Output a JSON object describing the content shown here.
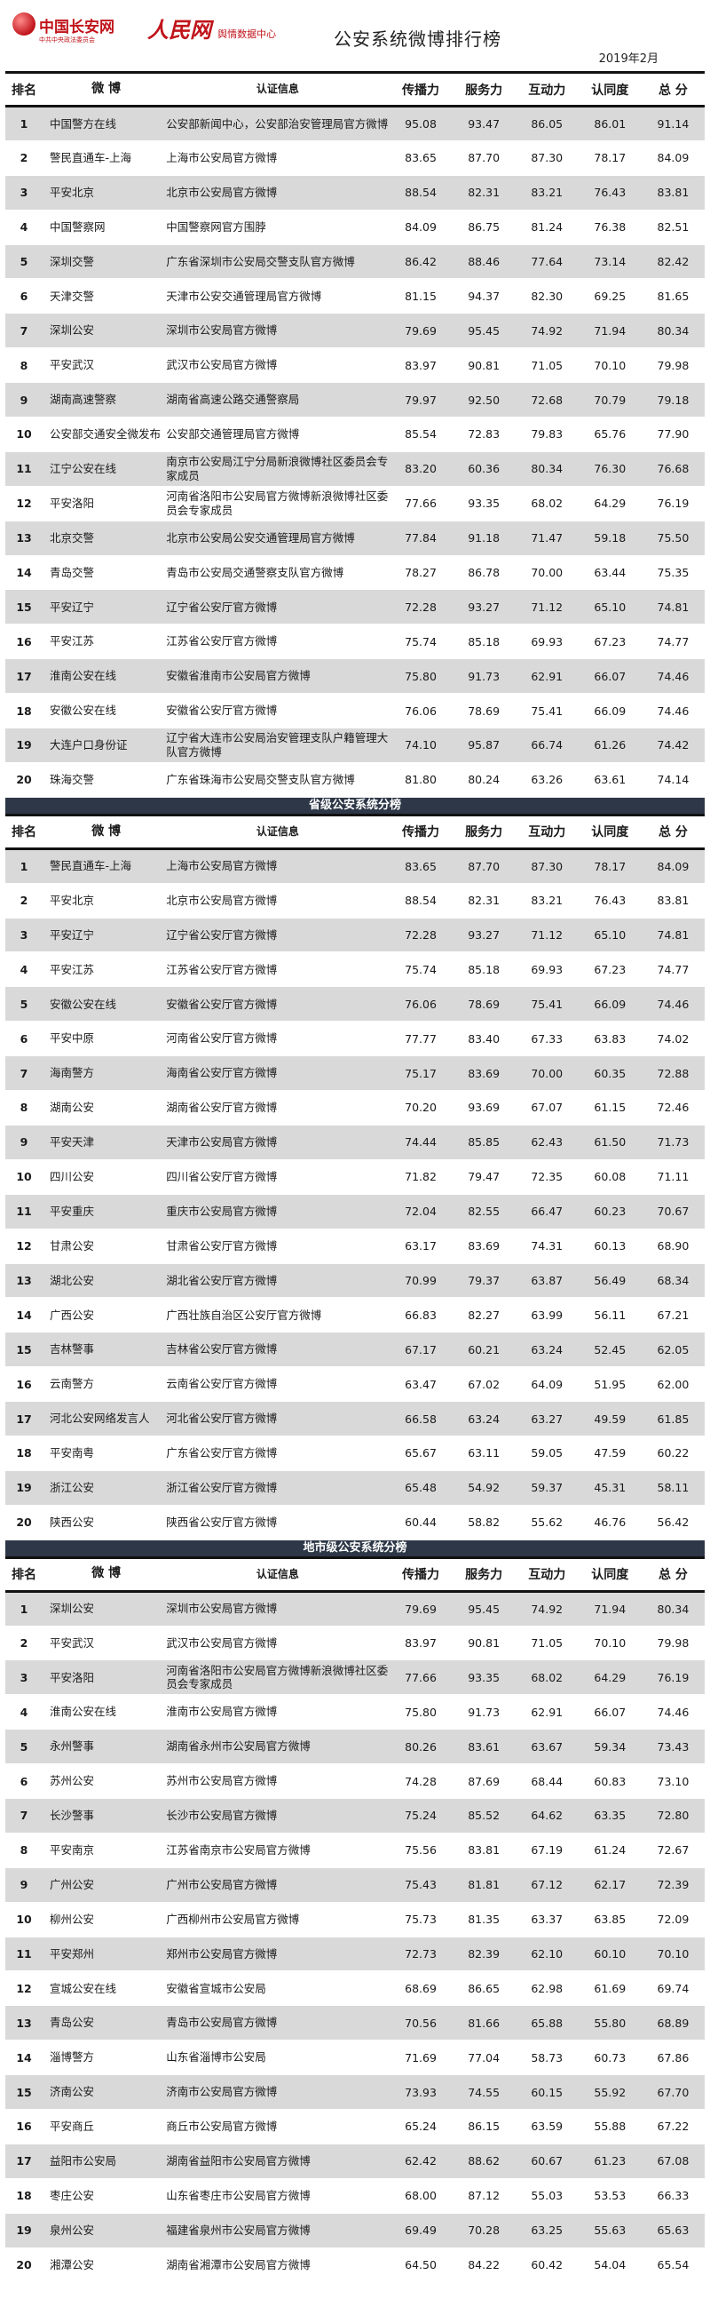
{
  "header": {
    "logo_name": "中国长安网",
    "logo_sub": "中共中央政法委员会",
    "rmw_brand": "人民网",
    "rmw_center": "舆情数据中心",
    "title": "公安系统微博排行榜",
    "date": "2019年2月"
  },
  "columns": {
    "rank": "排名",
    "name": "微  博",
    "cert": "认证信息",
    "spread": "传播力",
    "service": "服务力",
    "interact": "互动力",
    "recog": "认同度",
    "total": "总  分"
  },
  "sections": [
    {
      "title": "",
      "rows": [
        {
          "rank": "1",
          "name": "中国警方在线",
          "cert": "公安部新闻中心，公安部治安管理局官方微博",
          "spread": "95.08",
          "service": "93.47",
          "interact": "86.05",
          "recog": "86.01",
          "total": "91.14"
        },
        {
          "rank": "2",
          "name": "警民直通车-上海",
          "cert": "上海市公安局官方微博",
          "spread": "83.65",
          "service": "87.70",
          "interact": "87.30",
          "recog": "78.17",
          "total": "84.09"
        },
        {
          "rank": "3",
          "name": "平安北京",
          "cert": "北京市公安局官方微博",
          "spread": "88.54",
          "service": "82.31",
          "interact": "83.21",
          "recog": "76.43",
          "total": "83.81"
        },
        {
          "rank": "4",
          "name": "中国警察网",
          "cert": "中国警察网官方围脖",
          "spread": "84.09",
          "service": "86.75",
          "interact": "81.24",
          "recog": "76.38",
          "total": "82.51"
        },
        {
          "rank": "5",
          "name": "深圳交警",
          "cert": "广东省深圳市公安局交警支队官方微博",
          "spread": "86.42",
          "service": "88.46",
          "interact": "77.64",
          "recog": "73.14",
          "total": "82.42"
        },
        {
          "rank": "6",
          "name": "天津交警",
          "cert": "天津市公安交通管理局官方微博",
          "spread": "81.15",
          "service": "94.37",
          "interact": "82.30",
          "recog": "69.25",
          "total": "81.65"
        },
        {
          "rank": "7",
          "name": "深圳公安",
          "cert": "深圳市公安局官方微博",
          "spread": "79.69",
          "service": "95.45",
          "interact": "74.92",
          "recog": "71.94",
          "total": "80.34"
        },
        {
          "rank": "8",
          "name": "平安武汉",
          "cert": "武汉市公安局官方微博",
          "spread": "83.97",
          "service": "90.81",
          "interact": "71.05",
          "recog": "70.10",
          "total": "79.98"
        },
        {
          "rank": "9",
          "name": "湖南高速警察",
          "cert": "湖南省高速公路交通警察局",
          "spread": "79.97",
          "service": "92.50",
          "interact": "72.68",
          "recog": "70.79",
          "total": "79.18"
        },
        {
          "rank": "10",
          "name": "公安部交通安全微发布",
          "cert": "公安部交通管理局官方微博",
          "spread": "85.54",
          "service": "72.83",
          "interact": "79.83",
          "recog": "65.76",
          "total": "77.90"
        },
        {
          "rank": "11",
          "name": "江宁公安在线",
          "cert": "南京市公安局江宁分局新浪微博社区委员会专家成员",
          "spread": "83.20",
          "service": "60.36",
          "interact": "80.34",
          "recog": "76.30",
          "total": "76.68"
        },
        {
          "rank": "12",
          "name": "平安洛阳",
          "cert": "河南省洛阳市公安局官方微博新浪微博社区委员会专家成员",
          "spread": "77.66",
          "service": "93.35",
          "interact": "68.02",
          "recog": "64.29",
          "total": "76.19"
        },
        {
          "rank": "13",
          "name": "北京交警",
          "cert": "北京市公安局公安交通管理局官方微博",
          "spread": "77.84",
          "service": "91.18",
          "interact": "71.47",
          "recog": "59.18",
          "total": "75.50"
        },
        {
          "rank": "14",
          "name": "青岛交警",
          "cert": "青岛市公安局交通警察支队官方微博",
          "spread": "78.27",
          "service": "86.78",
          "interact": "70.00",
          "recog": "63.44",
          "total": "75.35"
        },
        {
          "rank": "15",
          "name": "平安辽宁",
          "cert": "辽宁省公安厅官方微博",
          "spread": "72.28",
          "service": "93.27",
          "interact": "71.12",
          "recog": "65.10",
          "total": "74.81"
        },
        {
          "rank": "16",
          "name": "平安江苏",
          "cert": "江苏省公安厅官方微博",
          "spread": "75.74",
          "service": "85.18",
          "interact": "69.93",
          "recog": "67.23",
          "total": "74.77"
        },
        {
          "rank": "17",
          "name": "淮南公安在线",
          "cert": "安徽省淮南市公安局官方微博",
          "spread": "75.80",
          "service": "91.73",
          "interact": "62.91",
          "recog": "66.07",
          "total": "74.46"
        },
        {
          "rank": "18",
          "name": "安徽公安在线",
          "cert": "安徽省公安厅官方微博",
          "spread": "76.06",
          "service": "78.69",
          "interact": "75.41",
          "recog": "66.09",
          "total": "74.46"
        },
        {
          "rank": "19",
          "name": "大连户口身份证",
          "cert": "辽宁省大连市公安局治安管理支队户籍管理大队官方微博",
          "spread": "74.10",
          "service": "95.87",
          "interact": "66.74",
          "recog": "61.26",
          "total": "74.42"
        },
        {
          "rank": "20",
          "name": "珠海交警",
          "cert": "广东省珠海市公安局交警支队官方微博",
          "spread": "81.80",
          "service": "80.24",
          "interact": "63.26",
          "recog": "63.61",
          "total": "74.14"
        }
      ]
    },
    {
      "title": "省级公安系统分榜",
      "rows": [
        {
          "rank": "1",
          "name": "警民直通车-上海",
          "cert": "上海市公安局官方微博",
          "spread": "83.65",
          "service": "87.70",
          "interact": "87.30",
          "recog": "78.17",
          "total": "84.09"
        },
        {
          "rank": "2",
          "name": "平安北京",
          "cert": "北京市公安局官方微博",
          "spread": "88.54",
          "service": "82.31",
          "interact": "83.21",
          "recog": "76.43",
          "total": "83.81"
        },
        {
          "rank": "3",
          "name": "平安辽宁",
          "cert": "辽宁省公安厅官方微博",
          "spread": "72.28",
          "service": "93.27",
          "interact": "71.12",
          "recog": "65.10",
          "total": "74.81"
        },
        {
          "rank": "4",
          "name": "平安江苏",
          "cert": "江苏省公安厅官方微博",
          "spread": "75.74",
          "service": "85.18",
          "interact": "69.93",
          "recog": "67.23",
          "total": "74.77"
        },
        {
          "rank": "5",
          "name": "安徽公安在线",
          "cert": "安徽省公安厅官方微博",
          "spread": "76.06",
          "service": "78.69",
          "interact": "75.41",
          "recog": "66.09",
          "total": "74.46"
        },
        {
          "rank": "6",
          "name": "平安中原",
          "cert": "河南省公安厅官方微博",
          "spread": "77.77",
          "service": "83.40",
          "interact": "67.33",
          "recog": "63.83",
          "total": "74.02"
        },
        {
          "rank": "7",
          "name": "海南警方",
          "cert": "海南省公安厅官方微博",
          "spread": "75.17",
          "service": "83.69",
          "interact": "70.00",
          "recog": "60.35",
          "total": "72.88"
        },
        {
          "rank": "8",
          "name": "湖南公安",
          "cert": "湖南省公安厅官方微博",
          "spread": "70.20",
          "service": "93.69",
          "interact": "67.07",
          "recog": "61.15",
          "total": "72.46"
        },
        {
          "rank": "9",
          "name": "平安天津",
          "cert": "天津市公安局官方微博",
          "spread": "74.44",
          "service": "85.85",
          "interact": "62.43",
          "recog": "61.50",
          "total": "71.73"
        },
        {
          "rank": "10",
          "name": "四川公安",
          "cert": "四川省公安厅官方微博",
          "spread": "71.82",
          "service": "79.47",
          "interact": "72.35",
          "recog": "60.08",
          "total": "71.11"
        },
        {
          "rank": "11",
          "name": "平安重庆",
          "cert": "重庆市公安局官方微博",
          "spread": "72.04",
          "service": "82.55",
          "interact": "66.47",
          "recog": "60.23",
          "total": "70.67"
        },
        {
          "rank": "12",
          "name": "甘肃公安",
          "cert": "甘肃省公安厅官方微博",
          "spread": "63.17",
          "service": "83.69",
          "interact": "74.31",
          "recog": "60.13",
          "total": "68.90"
        },
        {
          "rank": "13",
          "name": "湖北公安",
          "cert": "湖北省公安厅官方微博",
          "spread": "70.99",
          "service": "79.37",
          "interact": "63.87",
          "recog": "56.49",
          "total": "68.34"
        },
        {
          "rank": "14",
          "name": "广西公安",
          "cert": "广西壮族自治区公安厅官方微博",
          "spread": "66.83",
          "service": "82.27",
          "interact": "63.99",
          "recog": "56.11",
          "total": "67.21"
        },
        {
          "rank": "15",
          "name": "吉林警事",
          "cert": "吉林省公安厅官方微博",
          "spread": "67.17",
          "service": "60.21",
          "interact": "63.24",
          "recog": "52.45",
          "total": "62.05"
        },
        {
          "rank": "16",
          "name": "云南警方",
          "cert": "云南省公安厅官方微博",
          "spread": "63.47",
          "service": "67.02",
          "interact": "64.09",
          "recog": "51.95",
          "total": "62.00"
        },
        {
          "rank": "17",
          "name": "河北公安网络发言人",
          "cert": "河北省公安厅官方微博",
          "spread": "66.58",
          "service": "63.24",
          "interact": "63.27",
          "recog": "49.59",
          "total": "61.85"
        },
        {
          "rank": "18",
          "name": "平安南粤",
          "cert": "广东省公安厅官方微博",
          "spread": "65.67",
          "service": "63.11",
          "interact": "59.05",
          "recog": "47.59",
          "total": "60.22"
        },
        {
          "rank": "19",
          "name": "浙江公安",
          "cert": "浙江省公安厅官方微博",
          "spread": "65.48",
          "service": "54.92",
          "interact": "59.37",
          "recog": "45.31",
          "total": "58.11"
        },
        {
          "rank": "20",
          "name": "陕西公安",
          "cert": "陕西省公安厅官方微博",
          "spread": "60.44",
          "service": "58.82",
          "interact": "55.62",
          "recog": "46.76",
          "total": "56.42"
        }
      ]
    },
    {
      "title": "地市级公安系统分榜",
      "rows": [
        {
          "rank": "1",
          "name": "深圳公安",
          "cert": "深圳市公安局官方微博",
          "spread": "79.69",
          "service": "95.45",
          "interact": "74.92",
          "recog": "71.94",
          "total": "80.34"
        },
        {
          "rank": "2",
          "name": "平安武汉",
          "cert": "武汉市公安局官方微博",
          "spread": "83.97",
          "service": "90.81",
          "interact": "71.05",
          "recog": "70.10",
          "total": "79.98"
        },
        {
          "rank": "3",
          "name": "平安洛阳",
          "cert": "河南省洛阳市公安局官方微博新浪微博社区委员会专家成员",
          "spread": "77.66",
          "service": "93.35",
          "interact": "68.02",
          "recog": "64.29",
          "total": "76.19"
        },
        {
          "rank": "4",
          "name": "淮南公安在线",
          "cert": "淮南市公安局官方微博",
          "spread": "75.80",
          "service": "91.73",
          "interact": "62.91",
          "recog": "66.07",
          "total": "74.46"
        },
        {
          "rank": "5",
          "name": "永州警事",
          "cert": "湖南省永州市公安局官方微博",
          "spread": "80.26",
          "service": "83.61",
          "interact": "63.67",
          "recog": "59.34",
          "total": "73.43"
        },
        {
          "rank": "6",
          "name": "苏州公安",
          "cert": "苏州市公安局官方微博",
          "spread": "74.28",
          "service": "87.69",
          "interact": "68.44",
          "recog": "60.83",
          "total": "73.10"
        },
        {
          "rank": "7",
          "name": "长沙警事",
          "cert": "长沙市公安局官方微博",
          "spread": "75.24",
          "service": "85.52",
          "interact": "64.62",
          "recog": "63.35",
          "total": "72.80"
        },
        {
          "rank": "8",
          "name": "平安南京",
          "cert": "江苏省南京市公安局官方微博",
          "spread": "75.56",
          "service": "83.81",
          "interact": "67.19",
          "recog": "61.24",
          "total": "72.67"
        },
        {
          "rank": "9",
          "name": "广州公安",
          "cert": "广州市公安局官方微博",
          "spread": "75.43",
          "service": "81.81",
          "interact": "67.12",
          "recog": "62.17",
          "total": "72.39"
        },
        {
          "rank": "10",
          "name": "柳州公安",
          "cert": "广西柳州市公安局官方微博",
          "spread": "75.73",
          "service": "81.35",
          "interact": "63.37",
          "recog": "63.85",
          "total": "72.09"
        },
        {
          "rank": "11",
          "name": "平安郑州",
          "cert": "郑州市公安局官方微博",
          "spread": "72.73",
          "service": "82.39",
          "interact": "62.10",
          "recog": "60.10",
          "total": "70.10"
        },
        {
          "rank": "12",
          "name": "宣城公安在线",
          "cert": "安徽省宣城市公安局",
          "spread": "68.69",
          "service": "86.65",
          "interact": "62.98",
          "recog": "61.69",
          "total": "69.74"
        },
        {
          "rank": "13",
          "name": "青岛公安",
          "cert": "青岛市公安局官方微博",
          "spread": "70.56",
          "service": "81.66",
          "interact": "65.88",
          "recog": "55.80",
          "total": "68.89"
        },
        {
          "rank": "14",
          "name": "淄博警方",
          "cert": "山东省淄博市公安局",
          "spread": "71.69",
          "service": "77.04",
          "interact": "58.73",
          "recog": "60.73",
          "total": "67.86"
        },
        {
          "rank": "15",
          "name": "济南公安",
          "cert": "济南市公安局官方微博",
          "spread": "73.93",
          "service": "74.55",
          "interact": "60.15",
          "recog": "55.92",
          "total": "67.70"
        },
        {
          "rank": "16",
          "name": "平安商丘",
          "cert": "商丘市公安局官方微博",
          "spread": "65.24",
          "service": "86.15",
          "interact": "63.59",
          "recog": "55.88",
          "total": "67.22"
        },
        {
          "rank": "17",
          "name": "益阳市公安局",
          "cert": "湖南省益阳市公安局官方微博",
          "spread": "62.42",
          "service": "88.62",
          "interact": "60.67",
          "recog": "61.23",
          "total": "67.08"
        },
        {
          "rank": "18",
          "name": "枣庄公安",
          "cert": "山东省枣庄市公安局官方微博",
          "spread": "68.00",
          "service": "87.12",
          "interact": "55.03",
          "recog": "53.53",
          "total": "66.33"
        },
        {
          "rank": "19",
          "name": "泉州公安",
          "cert": "福建省泉州市公安局官方微博",
          "spread": "69.49",
          "service": "70.28",
          "interact": "63.25",
          "recog": "55.63",
          "total": "65.63"
        },
        {
          "rank": "20",
          "name": "湘潭公安",
          "cert": "湖南省湘潭市公安局官方微博",
          "spread": "64.50",
          "service": "84.22",
          "interact": "60.42",
          "recog": "54.04",
          "total": "65.54"
        }
      ]
    }
  ]
}
